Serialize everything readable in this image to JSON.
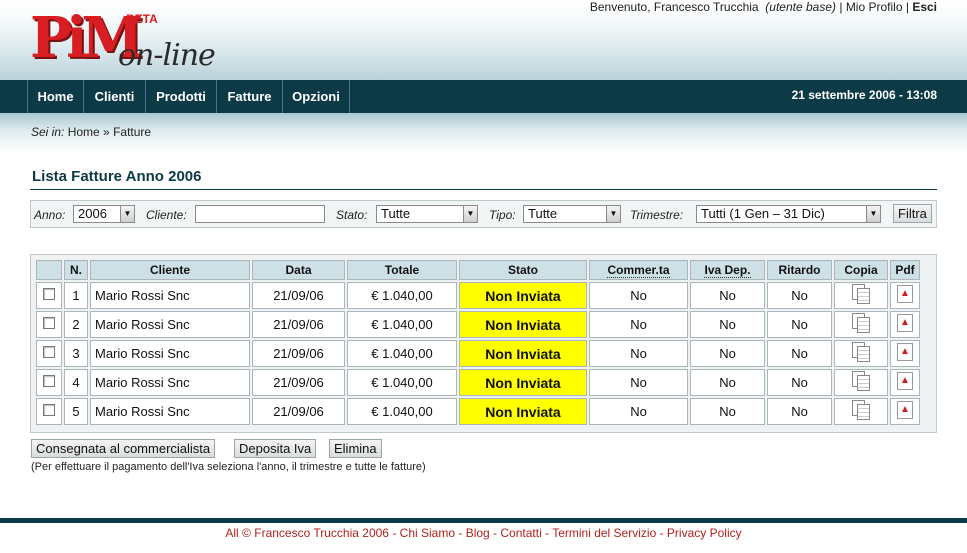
{
  "logo": {
    "main": "PiM",
    "beta": "BETA",
    "online": "on-line"
  },
  "welcome": {
    "greeting": "Benvenuto, Francesco Trucchia",
    "role": "(utente base)",
    "sep1": "|",
    "profile": "Mio Profilo",
    "sep2": "|",
    "logout": "Esci"
  },
  "nav": {
    "items": [
      "Home",
      "Clienti",
      "Prodotti",
      "Fatture",
      "Opzioni"
    ],
    "date": "21 settembre 2006 - 13:08"
  },
  "breadcrumb": {
    "prefix": "Sei in:",
    "home": "Home »",
    "current": "Fatture"
  },
  "page_title": "Lista Fatture Anno 2006",
  "filters": {
    "anno_label": "Anno:",
    "anno_value": "2006",
    "cliente_label": "Cliente:",
    "cliente_value": "",
    "stato_label": "Stato:",
    "stato_value": "Tutte",
    "tipo_label": "Tipo:",
    "tipo_value": "Tutte",
    "trimestre_label": "Trimestre:",
    "trimestre_value": "Tutti (1 Gen – 31 Dic)",
    "button": "Filtra"
  },
  "table": {
    "headers": [
      "",
      "N.",
      "Cliente",
      "Data",
      "Totale",
      "Stato",
      "Commer.ta",
      "Iva Dep.",
      "Ritardo",
      "Copia",
      "Pdf"
    ],
    "rows": [
      {
        "n": "1",
        "cliente": "Mario Rossi Snc",
        "data": "21/09/06",
        "totale": "€ 1.040,00",
        "stato": "Non Inviata",
        "commer": "No",
        "iva": "No",
        "ritardo": "No"
      },
      {
        "n": "2",
        "cliente": "Mario Rossi Snc",
        "data": "21/09/06",
        "totale": "€ 1.040,00",
        "stato": "Non Inviata",
        "commer": "No",
        "iva": "No",
        "ritardo": "No"
      },
      {
        "n": "3",
        "cliente": "Mario Rossi Snc",
        "data": "21/09/06",
        "totale": "€ 1.040,00",
        "stato": "Non Inviata",
        "commer": "No",
        "iva": "No",
        "ritardo": "No"
      },
      {
        "n": "4",
        "cliente": "Mario Rossi Snc",
        "data": "21/09/06",
        "totale": "€ 1.040,00",
        "stato": "Non Inviata",
        "commer": "No",
        "iva": "No",
        "ritardo": "No"
      },
      {
        "n": "5",
        "cliente": "Mario Rossi Snc",
        "data": "21/09/06",
        "totale": "€ 1.040,00",
        "stato": "Non Inviata",
        "commer": "No",
        "iva": "No",
        "ritardo": "No"
      }
    ]
  },
  "actions": {
    "consegnata": "Consegnata al commercialista",
    "deposita": "Deposita Iva",
    "elimina": "Elimina"
  },
  "note": "(Per effettuare il pagamento dell'Iva seleziona l'anno, il trimestre e tutte le fatture)",
  "footer": {
    "copyright": "All © Francesco Trucchia 2006",
    "links": [
      "Chi Siamo",
      "Blog",
      "Contatti",
      "Termini del Servizio",
      "Privacy Policy"
    ],
    "sep": " - "
  },
  "colors": {
    "nav_bg": "#0d3a47",
    "accent_red": "#d81e22",
    "status_yellow": "#ffff00",
    "header_cell": "#cde0e6"
  }
}
